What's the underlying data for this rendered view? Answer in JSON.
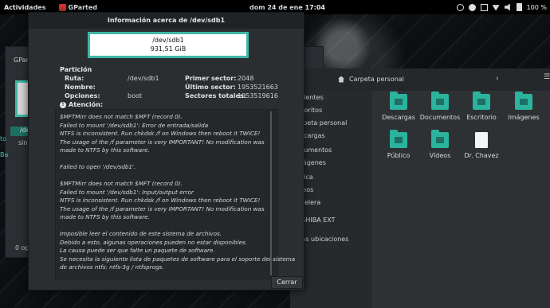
{
  "topbar": {
    "activities": "Actividades",
    "app_name": "GParted",
    "clock": "dom 24 de ene  17:04",
    "battery": "100 %"
  },
  "gparted": {
    "title_fragment": "GParted",
    "row_dev": "/de",
    "row_sin": "sin",
    "status": "0 op",
    "side_frag": "to",
    "side_frag2": "Ba"
  },
  "file_manager": {
    "location": "Carpeta personal",
    "places": [
      "ecientes",
      "avoritos",
      "arpeta personal",
      "escargas",
      "ocumentos",
      "mágenes",
      "úsica",
      "ídeos",
      "apelera",
      "OSHIBA EXT",
      "tras ubicaciones"
    ],
    "items": [
      {
        "label": "Descargas",
        "type": "folder"
      },
      {
        "label": "Documentos",
        "type": "folder"
      },
      {
        "label": "Escritorio",
        "type": "folder"
      },
      {
        "label": "Imágenes",
        "type": "folder"
      },
      {
        "label": "Público",
        "type": "folder"
      },
      {
        "label": "Vídeos",
        "type": "folder"
      },
      {
        "label": "Dr. Chavez",
        "type": "file"
      }
    ]
  },
  "dialog": {
    "title": "Información acerca de /dev/sdb1",
    "device": "/dev/sdb1",
    "size": "931,51 GiB",
    "section": "Partición",
    "fields": {
      "ruta_label": "Ruta:",
      "ruta_value": "/dev/sdb1",
      "nombre_label": "Nombre:",
      "opciones_label": "Opciones:",
      "opciones_value": "boot",
      "primer_label": "Primer sector:",
      "primer_value": "2048",
      "ultimo_label": "Último sector:",
      "ultimo_value": "1953521663",
      "totales_label": "Sectores totales:",
      "totales_value": "1953519616"
    },
    "warning_title": "Atención:",
    "message": "$MFTMirr does not match $MFT (record 0).\nFailed to mount '/dev/sdb1': Error de entrada/salida\nNTFS is inconsistent. Run chkdsk /f on Windows then reboot it TWICE!\nThe usage of the /f parameter is very IMPORTANT! No modification was\nmade to NTFS by this software.\n\nFailed to open '/dev/sdb1'.\n\n$MFTMirr does not match $MFT (record 0).\nFailed to mount '/dev/sdb1': Input/output error\nNTFS is inconsistent. Run chkdsk /f on Windows then reboot it TWICE!\nThe usage of the /f parameter is very IMPORTANT! No modification was\nmade to NTFS by this software.\n\nImposible leer el contenido de este sistema de archivos.\nDebido a esto, algunas operaciones pueden no estar disponibles.\nLa causa puede ser que falte un paquete de software.\nSe necesita la siguiente lista de paquetes de software para el soporte del sistema\nde archivos ntfs: ntfs-3g / ntfsprogs.",
    "close_label": "Cerrar"
  },
  "colors": {
    "accent": "#3fb8a6",
    "folder": "#2bb39d"
  }
}
